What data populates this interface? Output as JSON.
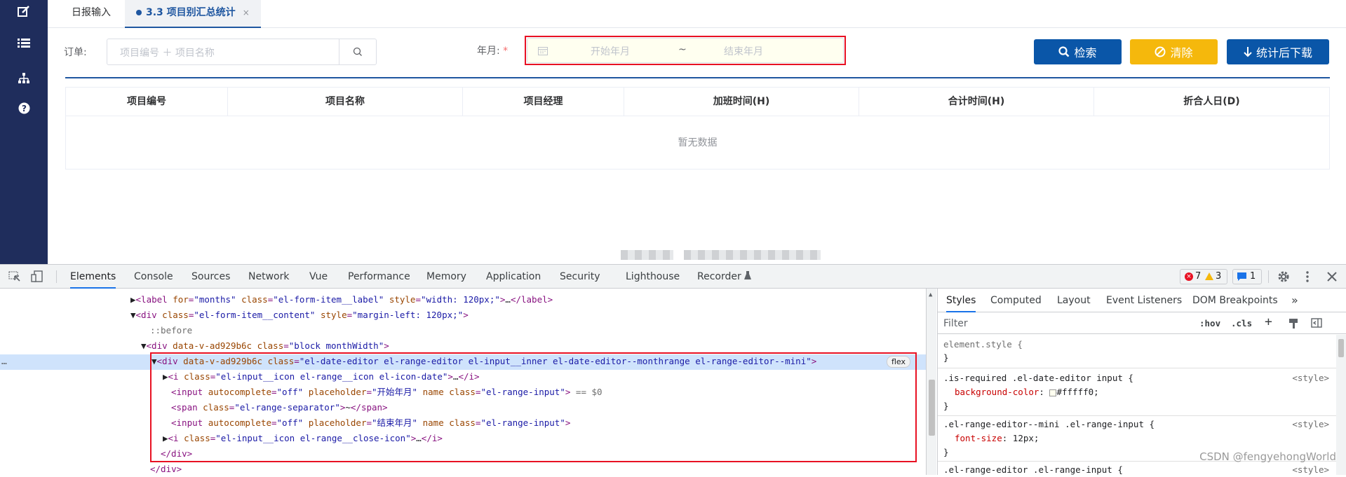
{
  "tabs": [
    {
      "label": "日报输入"
    },
    {
      "label": "3.3 项目别汇总统计",
      "close": "×"
    }
  ],
  "filters": {
    "order_label": "订单:",
    "order_placeholder": "项目编号 ＋ 项目名称",
    "date_label": "年月:",
    "required_mark": "*",
    "start_placeholder": "开始年月",
    "separator": "~",
    "end_placeholder": "结束年月"
  },
  "buttons": {
    "search": "检索",
    "clear": "清除",
    "download": "统计后下载"
  },
  "table": {
    "columns": [
      "项目编号",
      "项目名称",
      "项目经理",
      "加班时间(H)",
      "合计时间(H)",
      "折合人日(D)"
    ],
    "empty_text": "暂无数据"
  },
  "devtools": {
    "tabs": [
      "Elements",
      "Console",
      "Sources",
      "Network",
      "Vue",
      "Performance",
      "Memory",
      "Application",
      "Security",
      "Lighthouse",
      "Recorder"
    ],
    "errors": "7",
    "warnings": "3",
    "messages": "1",
    "styles_tabs": [
      "Styles",
      "Computed",
      "Layout",
      "Event Listeners",
      "DOM Breakpoints"
    ],
    "more": "»",
    "filter_placeholder": "Filter",
    "hov": ":hov",
    "cls": ".cls",
    "flex_badge": "flex",
    "dollar": "== $0",
    "ellipsis": "…",
    "styles": {
      "r1_sel": "element.style {",
      "close": "}",
      "r2_sel": ".is-required .el-date-editor input {",
      "r2_prop": "background-color",
      "r2_val": "#fffff0;",
      "r3_sel": ".el-range-editor--mini .el-range-input {",
      "r3_prop": "font-size",
      "r3_val": "12px;",
      "r4_sel": ".el-range-editor .el-range-input {",
      "source": "<style>"
    }
  },
  "watermark": "CSDN @fengyehongWorld",
  "colors": {
    "sidebar": "#1f2d5c",
    "primary": "#0a56a8",
    "warning": "#f5b80c",
    "danger": "#e81123"
  }
}
